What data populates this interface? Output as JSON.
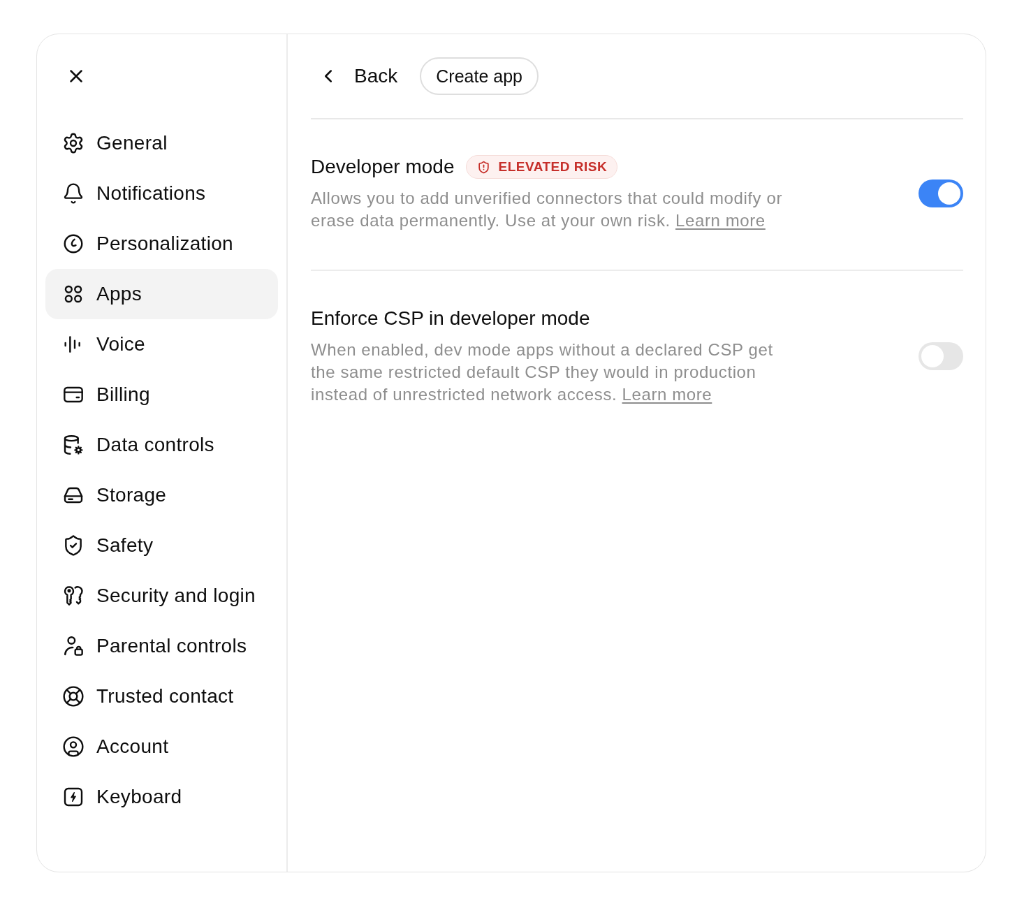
{
  "sidebar": {
    "items": [
      {
        "label": "General",
        "selected": false
      },
      {
        "label": "Notifications",
        "selected": false
      },
      {
        "label": "Personalization",
        "selected": false
      },
      {
        "label": "Apps",
        "selected": true
      },
      {
        "label": "Voice",
        "selected": false
      },
      {
        "label": "Billing",
        "selected": false
      },
      {
        "label": "Data controls",
        "selected": false
      },
      {
        "label": "Storage",
        "selected": false
      },
      {
        "label": "Safety",
        "selected": false
      },
      {
        "label": "Security and login",
        "selected": false
      },
      {
        "label": "Parental controls",
        "selected": false
      },
      {
        "label": "Trusted contact",
        "selected": false
      },
      {
        "label": "Account",
        "selected": false
      },
      {
        "label": "Keyboard",
        "selected": false
      }
    ]
  },
  "header": {
    "back": "Back",
    "create_button": "Create app"
  },
  "settings": [
    {
      "title": "Developer mode",
      "badge": "ELEVATED RISK",
      "description": "Allows you to add unverified connectors that could modify or erase data permanently. Use at your own risk.",
      "link": "Learn more",
      "on": true
    },
    {
      "title": "Enforce CSP in developer mode",
      "description": "When enabled, dev mode apps without a declared CSP get the same restricted default CSP they would in production instead of unrestricted network access.",
      "link": "Learn more",
      "on": false
    }
  ]
}
